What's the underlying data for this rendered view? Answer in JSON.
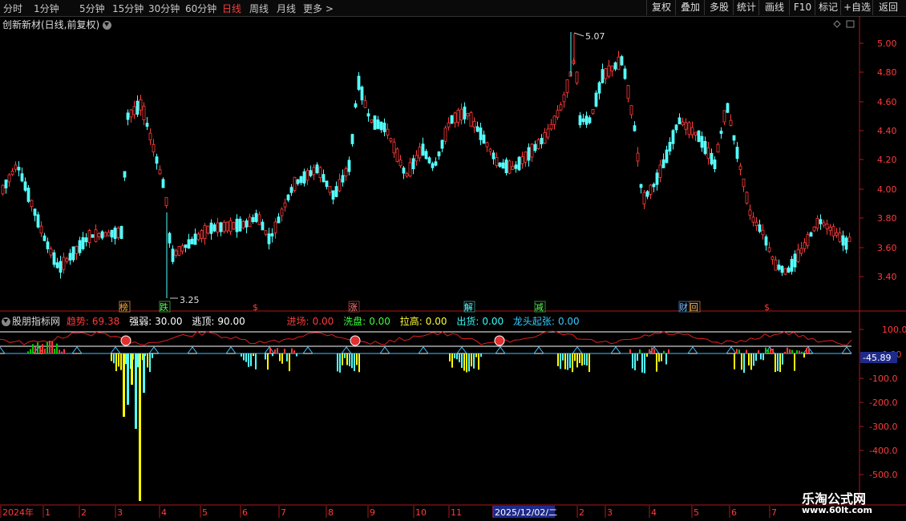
{
  "toolbar": {
    "periods": [
      "分时",
      "1分钟",
      "5分钟",
      "15分钟",
      "30分钟",
      "60分钟",
      "日线",
      "周线",
      "月线",
      "更多 >"
    ],
    "active_period": "日线",
    "right_buttons": [
      "复权",
      "叠加",
      "多股",
      "统计",
      "画线",
      "F10",
      "标记",
      "+自选",
      "返回"
    ]
  },
  "chart_title": "创新新材(日线,前复权)",
  "price_axis": [
    "5.00",
    "4.80",
    "4.60",
    "4.40",
    "4.20",
    "4.00",
    "3.80",
    "3.60",
    "3.40"
  ],
  "high_label": "5.07",
  "low_label": "3.25",
  "event_markers": [
    "榜",
    "跌",
    "$",
    "涨",
    "解",
    "减",
    "财",
    "回",
    "$"
  ],
  "indicator": {
    "name": "股朋指标网",
    "items": [
      {
        "label": "趋势:",
        "value": "69.38",
        "color": "#ff3b3b"
      },
      {
        "label": "强弱:",
        "value": "30.00",
        "color": "#ffffff"
      },
      {
        "label": "逃顶:",
        "value": "90.00",
        "color": "#ffffff"
      },
      {
        "label": "进场:",
        "value": "0.00",
        "color": "#ff3b3b"
      },
      {
        "label": "洗盘:",
        "value": "0.00",
        "color": "#3cff3c"
      },
      {
        "label": "拉高:",
        "value": "0.00",
        "color": "#ffff33"
      },
      {
        "label": "出货:",
        "value": "0.00",
        "color": "#33ffff"
      },
      {
        "label": "龙头起张:",
        "value": "0.00",
        "color": "#33ccff"
      }
    ],
    "axis": [
      "100.0",
      "0.00",
      "-100.0",
      "-200.0",
      "-300.0",
      "-400.0",
      "-500.0"
    ],
    "current_value": "-45.89"
  },
  "time_axis": [
    "2024年",
    "1",
    "2",
    "3",
    "4",
    "5",
    "6",
    "7",
    "8",
    "9",
    "10",
    "11",
    "2025/12/02/二",
    "2",
    "3",
    "4",
    "5",
    "6",
    "7"
  ],
  "watermark": {
    "name": "乐淘公式网",
    "url": "www.60lt.com"
  },
  "colors": {
    "up": "#ff3b3b",
    "down": "#54ffff",
    "axis": "#b01818",
    "yellow": "#ffff00",
    "green": "#00cc00"
  }
}
